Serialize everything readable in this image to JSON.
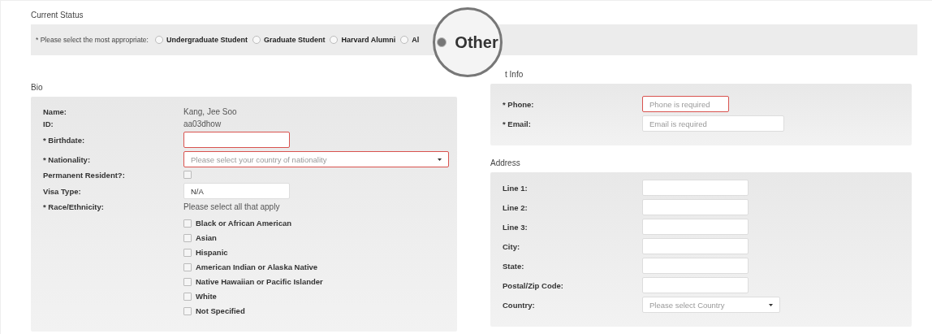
{
  "status": {
    "heading": "Current Status",
    "prompt": "* Please select the most appropriate:",
    "options": [
      {
        "label": "Undergraduate Student",
        "selected": false,
        "kind": "radio"
      },
      {
        "label": "Graduate Student",
        "selected": false,
        "kind": "radio"
      },
      {
        "label": "Harvard Alumni",
        "selected": false,
        "kind": "radio"
      },
      {
        "label": "Al",
        "selected": false,
        "kind": "radio"
      },
      {
        "label": "Other",
        "selected": true,
        "kind": "magnified"
      }
    ]
  },
  "bio": {
    "heading": "Bio",
    "rows": [
      {
        "kind": "text",
        "label": "Name:",
        "value": "Kang, Jee Soo"
      },
      {
        "kind": "text",
        "label": "ID:",
        "value": "aa03dhow"
      },
      {
        "kind": "input",
        "label": "* Birthdate:",
        "invalid": true
      },
      {
        "kind": "select",
        "label": "* Nationality:",
        "placeholder": "Please select your country of nationality",
        "invalid": true
      },
      {
        "kind": "checkbox",
        "label": "Permanent Resident?:",
        "checked": false
      },
      {
        "kind": "input",
        "label": "Visa Type:",
        "value": "N/A",
        "invalid": false
      },
      {
        "kind": "text",
        "label": "* Race/Ethnicity:",
        "value": "Please select all that apply"
      }
    ],
    "race_options": [
      {
        "label": "Black or African American",
        "checked": false
      },
      {
        "label": "Asian",
        "checked": false
      },
      {
        "label": "Hispanic",
        "checked": false
      },
      {
        "label": "American Indian or Alaska Native",
        "checked": false
      },
      {
        "label": "Native Hawaiian or Pacific Islander",
        "checked": false
      },
      {
        "label": "White",
        "checked": false
      },
      {
        "label": "Not Specified",
        "checked": false
      }
    ]
  },
  "contact": {
    "heading": "t Info",
    "rows": [
      {
        "kind": "input",
        "label": "* Phone:",
        "placeholder": "Phone is required",
        "invalid": true,
        "wide": false
      },
      {
        "kind": "input",
        "label": "* Email:",
        "placeholder": "Email is required",
        "invalid": false,
        "wide": true
      }
    ]
  },
  "address": {
    "heading": "Address",
    "rows": [
      {
        "kind": "input",
        "label": "Line 1:",
        "invalid": false
      },
      {
        "kind": "input",
        "label": "Line 2:",
        "invalid": false
      },
      {
        "kind": "input",
        "label": "Line 3:",
        "invalid": false
      },
      {
        "kind": "input",
        "label": "City:",
        "invalid": false
      },
      {
        "kind": "input",
        "label": "State:",
        "invalid": false
      },
      {
        "kind": "input",
        "label": "Postal/Zip Code:",
        "invalid": false
      },
      {
        "kind": "select",
        "label": "Country:",
        "placeholder": "Please select Country",
        "invalid": false
      }
    ]
  }
}
